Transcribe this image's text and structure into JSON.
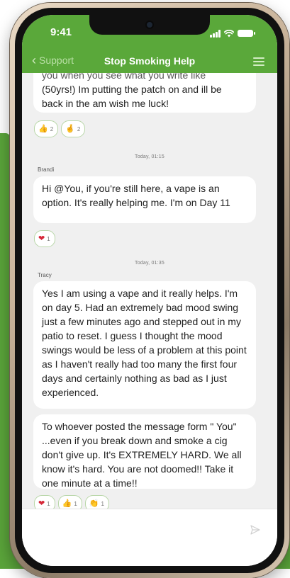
{
  "status_bar": {
    "time": "9:41"
  },
  "header": {
    "back_label": "Support",
    "title": "Stop Smoking Help"
  },
  "messages": [
    {
      "text_lines": [
        "you when you see what you write like",
        "(50yrs!) Im putting the patch on and ill be",
        "back in the am wish me luck!"
      ],
      "reactions": [
        {
          "icon": "thumbs-up-icon",
          "count": "2"
        },
        {
          "icon": "crossed-fingers-icon",
          "count": "2"
        }
      ]
    },
    {
      "timestamp": "Today, 01:15",
      "author": "Brandi",
      "text": "Hi @You, if you're still here, a vape is an option. It's really helping me. I'm on Day 11",
      "reactions": [
        {
          "icon": "heart-icon",
          "count": "1"
        }
      ]
    },
    {
      "timestamp": "Today, 01:35",
      "author": "Tracy",
      "text": "Yes I am using a vape and it really helps. I'm on day 5.  Had an extremely bad mood swing just a few minutes ago and stepped out in my patio to reset.  I guess I thought the mood swings would be less of a problem at this point as I haven't really had too many the first four days and certainly nothing as bad as I just experienced."
    },
    {
      "text": "To whoever posted the message form \" You\" ...even if you break down and smoke a cig don't give up.  It's EXTREMELY HARD.  We all know it's hard.  You are not doomed!! Take it one minute at a time!!",
      "reactions": [
        {
          "icon": "heart-icon",
          "count": "1"
        },
        {
          "icon": "thumbs-up-icon",
          "count": "1"
        },
        {
          "icon": "clapping-hands-icon",
          "count": "1"
        }
      ]
    }
  ],
  "composer": {
    "placeholder": ""
  },
  "colors": {
    "brand_green": "#5aa83a",
    "background_green": "#5aa43a",
    "chat_bg": "#f0f0f0",
    "heart": "#d62839"
  }
}
